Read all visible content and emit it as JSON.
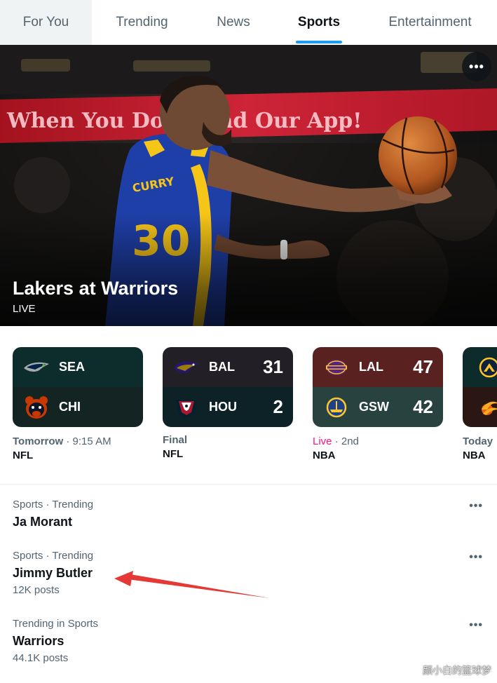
{
  "tabs": [
    {
      "label": "For You"
    },
    {
      "label": "Trending"
    },
    {
      "label": "News"
    },
    {
      "label": "Sports"
    },
    {
      "label": "Entertainment"
    }
  ],
  "active_tab": "Sports",
  "hero": {
    "title": "Lakers at Warriors",
    "subtitle": "LIVE",
    "more_label": "•••",
    "jersey_name": "CURRY",
    "jersey_number": "30",
    "banner_text": "When You Download Our App!"
  },
  "games": [
    {
      "teams": [
        {
          "abbr": "SEA",
          "score": "",
          "logo": "seahawks-logo"
        },
        {
          "abbr": "CHI",
          "score": "",
          "logo": "bears-logo"
        }
      ],
      "status_bold": "Tomorrow",
      "status_rest": " · 9:15 AM",
      "league": "NFL",
      "colors": {
        "top": "#0c2d2b",
        "bottom": "#132422"
      }
    },
    {
      "teams": [
        {
          "abbr": "BAL",
          "score": "31",
          "logo": "ravens-logo"
        },
        {
          "abbr": "HOU",
          "score": "2",
          "logo": "texans-logo"
        }
      ],
      "status_bold": "Final",
      "status_rest": "",
      "league": "NFL",
      "colors": {
        "top": "#231f26",
        "bottom": "#0c2226"
      }
    },
    {
      "teams": [
        {
          "abbr": "LAL",
          "score": "47",
          "logo": "lakers-logo"
        },
        {
          "abbr": "GSW",
          "score": "42",
          "logo": "warriors-logo"
        }
      ],
      "status_bold": "Live",
      "status_rest": " · 2nd",
      "league": "NBA",
      "colors": {
        "top": "#5a2121",
        "bottom": "#27423f"
      }
    },
    {
      "teams": [
        {
          "abbr": "",
          "score": "",
          "logo": "nuggets-logo"
        },
        {
          "abbr": "",
          "score": "",
          "logo": "suns-logo"
        }
      ],
      "status_bold": "Today",
      "status_rest": "",
      "league": "NBA",
      "colors": {
        "top": "#0d2b2a",
        "bottom": "#2a1612"
      }
    }
  ],
  "trends": [
    {
      "context": "Sports · Trending",
      "name": "Ja Morant",
      "count": ""
    },
    {
      "context": "Sports · Trending",
      "name": "Jimmy Butler",
      "count": "12K posts"
    },
    {
      "context": "Trending in Sports",
      "name": "Warriors",
      "count": "44.1K posts"
    }
  ],
  "more_label": "•••",
  "watermark": "颜小白的篮球梦",
  "colors": {
    "accent": "#1d9bf0",
    "live": "#f91880",
    "arrow": "#e53935",
    "secondary_text": "#536471"
  }
}
